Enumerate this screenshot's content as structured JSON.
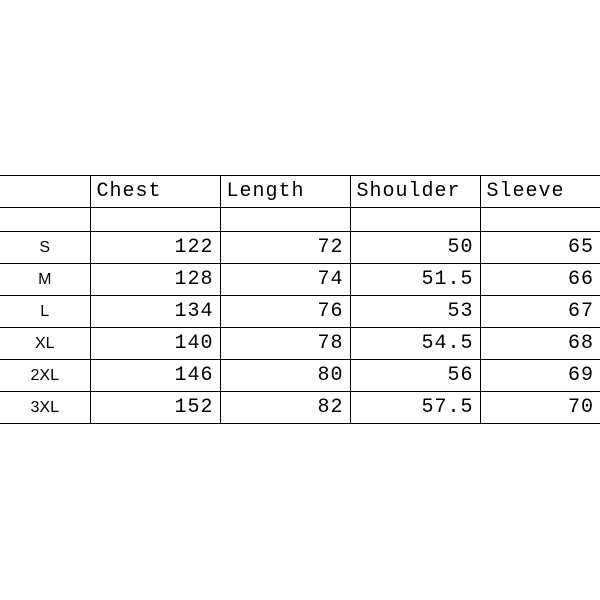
{
  "chart_data": {
    "type": "table",
    "title": "",
    "columns": [
      "",
      "Chest",
      "Length",
      "Shoulder",
      "Sleeve"
    ],
    "rows": [
      {
        "size": "S",
        "chest": 122,
        "length": 72,
        "shoulder": 50,
        "sleeve": 65
      },
      {
        "size": "M",
        "chest": 128,
        "length": 74,
        "shoulder": 51.5,
        "sleeve": 66
      },
      {
        "size": "L",
        "chest": 134,
        "length": 76,
        "shoulder": 53,
        "sleeve": 67
      },
      {
        "size": "XL",
        "chest": 140,
        "length": 78,
        "shoulder": 54.5,
        "sleeve": 68
      },
      {
        "size": "2XL",
        "chest": 146,
        "length": 80,
        "shoulder": 56,
        "sleeve": 69
      },
      {
        "size": "3XL",
        "chest": 152,
        "length": 82,
        "shoulder": 57.5,
        "sleeve": 70
      }
    ]
  }
}
